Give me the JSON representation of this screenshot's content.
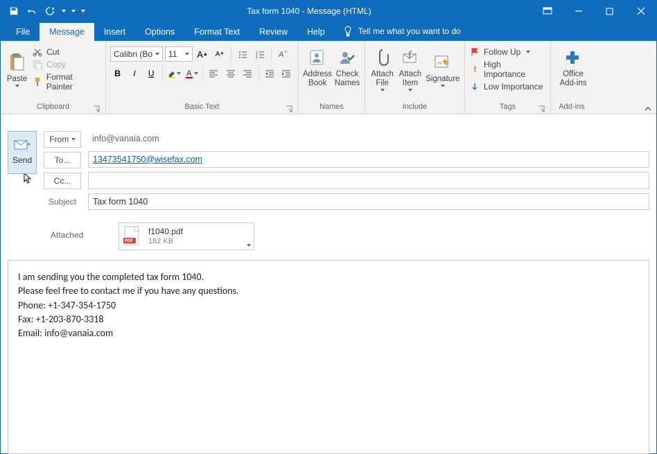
{
  "title": "Tax form 1040  -  Message (HTML)",
  "tabs": {
    "file": "File",
    "message": "Message",
    "insert": "Insert",
    "options": "Options",
    "format": "Format Text",
    "review": "Review",
    "help": "Help",
    "tellme": "Tell me what you want to do"
  },
  "ribbon": {
    "clipboard": {
      "paste": "Paste",
      "cut": "Cut",
      "copy": "Copy",
      "format_painter": "Format Painter",
      "label": "Clipboard"
    },
    "font": {
      "name": "Calibri (Bo",
      "size": "11",
      "label": "Basic Text"
    },
    "names": {
      "address_book": "Address\nBook",
      "check_names": "Check\nNames",
      "label": "Names"
    },
    "include": {
      "attach_file": "Attach\nFile",
      "attach_item": "Attach\nItem",
      "signature": "Signature",
      "label": "Include"
    },
    "tags": {
      "follow_up": "Follow Up",
      "high": "High Importance",
      "low": "Low Importance",
      "label": "Tags"
    },
    "addins": {
      "office": "Office\nAdd-ins",
      "label": "Add-ins"
    }
  },
  "compose": {
    "send": "Send",
    "from_label": "From",
    "from_value": "info@vanaia.com",
    "to_label": "To...",
    "to_value": "13473541750@wisefax.com",
    "cc_label": "Cc...",
    "cc_value": "",
    "subject_label": "Subject",
    "subject_value": "Tax form 1040",
    "attached_label": "Attached",
    "attachment_name": "f1040.pdf",
    "attachment_size": "182 KB"
  },
  "body": {
    "l1": "I am sending you the completed tax form 1040.",
    "l2": "Please feel free to contact me if you have any questions.",
    "l3": "Phone: +1-347-354-1750",
    "l4": "Fax: +1-203-870-3318",
    "l5": "Email: info@vanaia.com"
  }
}
